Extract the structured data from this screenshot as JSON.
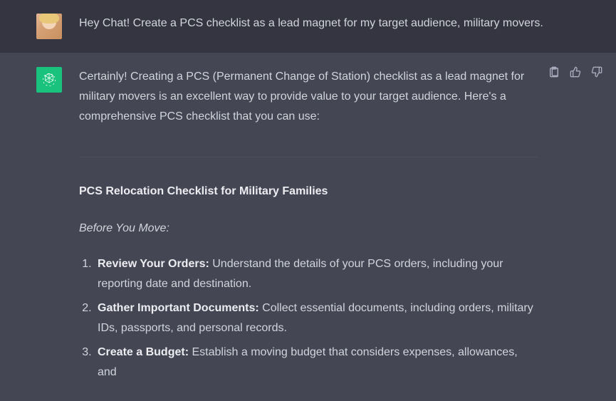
{
  "user_message": "Hey Chat! Create a PCS checklist as a lead magnet for my target audience, military movers.",
  "assistant": {
    "intro": "Certainly! Creating a PCS (Permanent Change of Station) checklist as a lead magnet for military movers is an excellent way to provide value to your target audience. Here's a comprehensive PCS checklist that you can use:",
    "checklist_title": "PCS Relocation Checklist for Military Families",
    "section_label": "Before You Move:",
    "items": [
      {
        "label": "Review Your Orders:",
        "text": " Understand the details of your PCS orders, including your reporting date and destination."
      },
      {
        "label": "Gather Important Documents:",
        "text": " Collect essential documents, including orders, military IDs, passports, and personal records."
      },
      {
        "label": "Create a Budget:",
        "text": " Establish a moving budget that considers expenses, allowances, and"
      }
    ]
  }
}
